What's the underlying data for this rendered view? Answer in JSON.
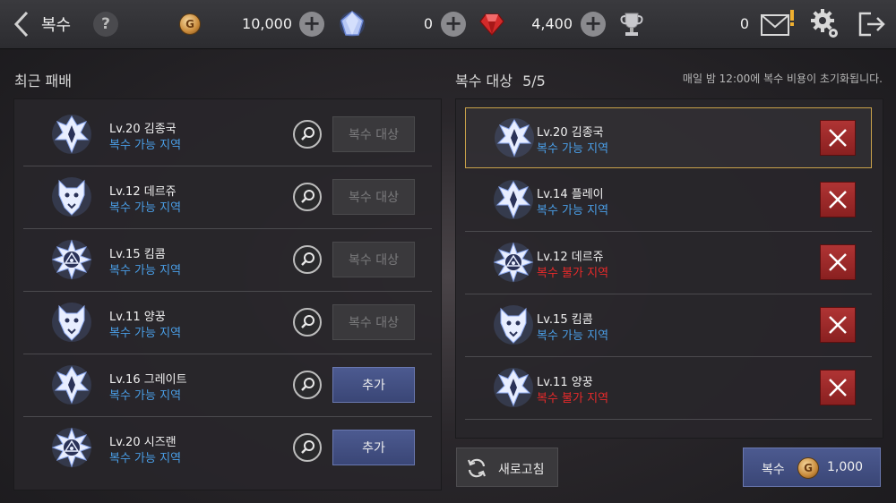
{
  "header": {
    "title": "복수",
    "help_label": "?",
    "gold": "10,000",
    "crystal": "0",
    "ruby": "4,400",
    "trophy": "0"
  },
  "left": {
    "title": "최근 패배",
    "rows": [
      {
        "name": "Lv.20 김종국",
        "area": "복수 가능 지역",
        "area_status": "possible",
        "button": "복수 대상",
        "enabled": false
      },
      {
        "name": "Lv.12 데르쥬",
        "area": "복수 가능 지역",
        "area_status": "possible",
        "button": "복수 대상",
        "enabled": false
      },
      {
        "name": "Lv.15 킴콤",
        "area": "복수 가능 지역",
        "area_status": "possible",
        "button": "복수 대상",
        "enabled": false
      },
      {
        "name": "Lv.11 양꿍",
        "area": "복수 가능 지역",
        "area_status": "possible",
        "button": "복수 대상",
        "enabled": false
      },
      {
        "name": "Lv.16 그레이트",
        "area": "복수 가능 지역",
        "area_status": "possible",
        "button": "추가",
        "enabled": true
      },
      {
        "name": "Lv.20 시즈랜",
        "area": "복수 가능 지역",
        "area_status": "possible",
        "button": "추가",
        "enabled": true
      }
    ]
  },
  "right": {
    "title": "복수 대상",
    "count": "5/5",
    "notice": "매일 밤 12:00에 복수 비용이 초기화됩니다.",
    "rows": [
      {
        "name": "Lv.20 김종국",
        "area": "복수 가능 지역",
        "area_status": "possible",
        "selected": true
      },
      {
        "name": "Lv.14 플레이",
        "area": "복수 가능 지역",
        "area_status": "possible",
        "selected": false
      },
      {
        "name": "Lv.12 데르쥬",
        "area": "복수 불가 지역",
        "area_status": "impossible",
        "selected": false
      },
      {
        "name": "Lv.15 킴콤",
        "area": "복수 가능 지역",
        "area_status": "possible",
        "selected": false
      },
      {
        "name": "Lv.11 양꿍",
        "area": "복수 불가 지역",
        "area_status": "impossible",
        "selected": false
      }
    ],
    "refresh_label": "새로고침",
    "revenge_label": "복수",
    "revenge_cost": "1,000"
  },
  "icons": {
    "gold": "gold-coin-icon",
    "crystal": "blue-crystal-icon",
    "ruby": "red-ruby-icon",
    "trophy": "trophy-icon",
    "mail": "mail-icon",
    "settings": "gear-icon",
    "exit": "exit-icon",
    "search": "search-icon",
    "remove": "close-icon",
    "refresh": "refresh-icon"
  },
  "colors": {
    "possible": "#4a9fe8",
    "impossible": "#e82a2a",
    "selected_border": "#c9a24a"
  }
}
